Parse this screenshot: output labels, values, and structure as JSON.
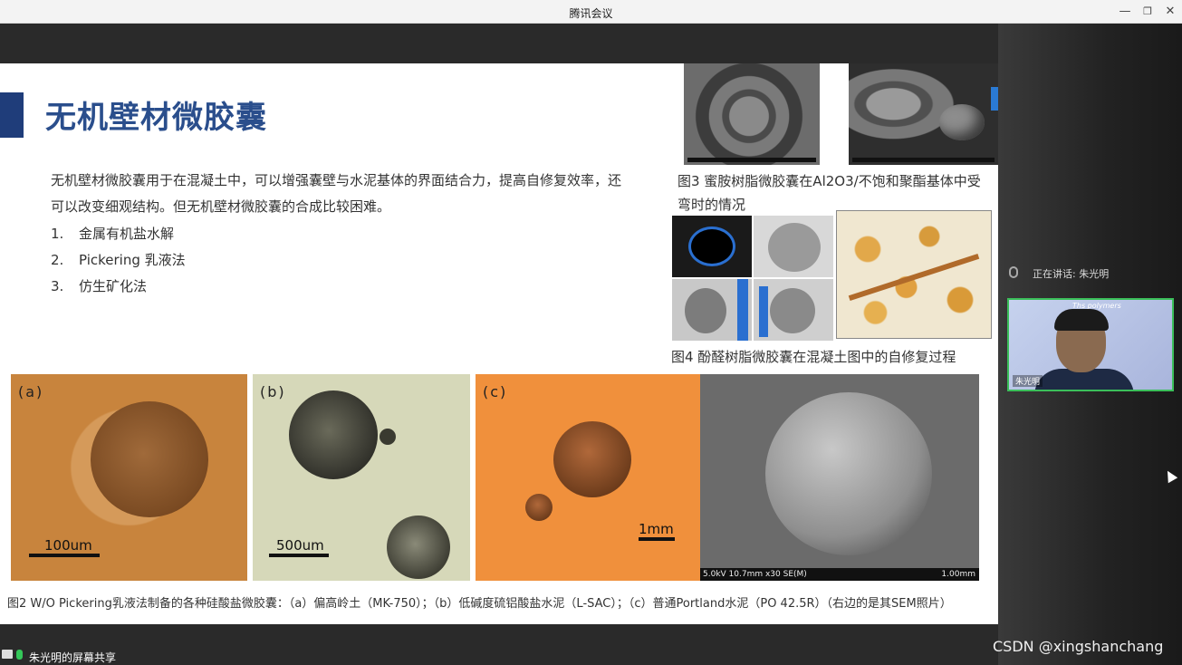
{
  "window": {
    "title": "腾讯会议"
  },
  "slide": {
    "title": "无机壁材微胶囊",
    "intro": "无机壁材微胶囊用于在混凝土中，可以增强囊壁与水泥基体的界面结合力，提高自修复效率，还可以改变细观结构。但无机壁材微胶囊的合成比较困难。",
    "list": [
      {
        "num": "1.",
        "text": "金属有机盐水解"
      },
      {
        "num": "2.",
        "text": "Pickering 乳液法"
      },
      {
        "num": "3.",
        "text": "仿生矿化法"
      }
    ],
    "fig3_caption": "图3 蜜胺树脂微胶囊在Al2O3/不饱和聚酯基体中受弯时的情况",
    "fig4_caption": "图4 酚醛树脂微胶囊在混凝土图中的自修复过程",
    "panels": [
      {
        "label": "(a)",
        "scale": "100um"
      },
      {
        "label": "(b)",
        "scale": "500um"
      },
      {
        "label": "(c)",
        "scale": "1mm"
      }
    ],
    "sem_footer_left": "5.0kV 10.7mm x30 SE(M)",
    "sem_footer_right": "1.00mm",
    "fig2_caption": "图2 W/O Pickering乳液法制备的各种硅酸盐微胶囊：（a）偏高岭土（MK-750）；（b）低碱度硫铝酸盐水泥（L-SAC）；（c）普通Portland水泥（PO 42.5R）（右边的是其SEM照片）"
  },
  "meeting": {
    "speaking_label": "正在讲话: 朱光明",
    "participant_name": "朱光明",
    "video_logo": "Ths polymers",
    "share_label": "朱光明的屏幕共享"
  },
  "watermark": "CSDN @xingshanchang"
}
